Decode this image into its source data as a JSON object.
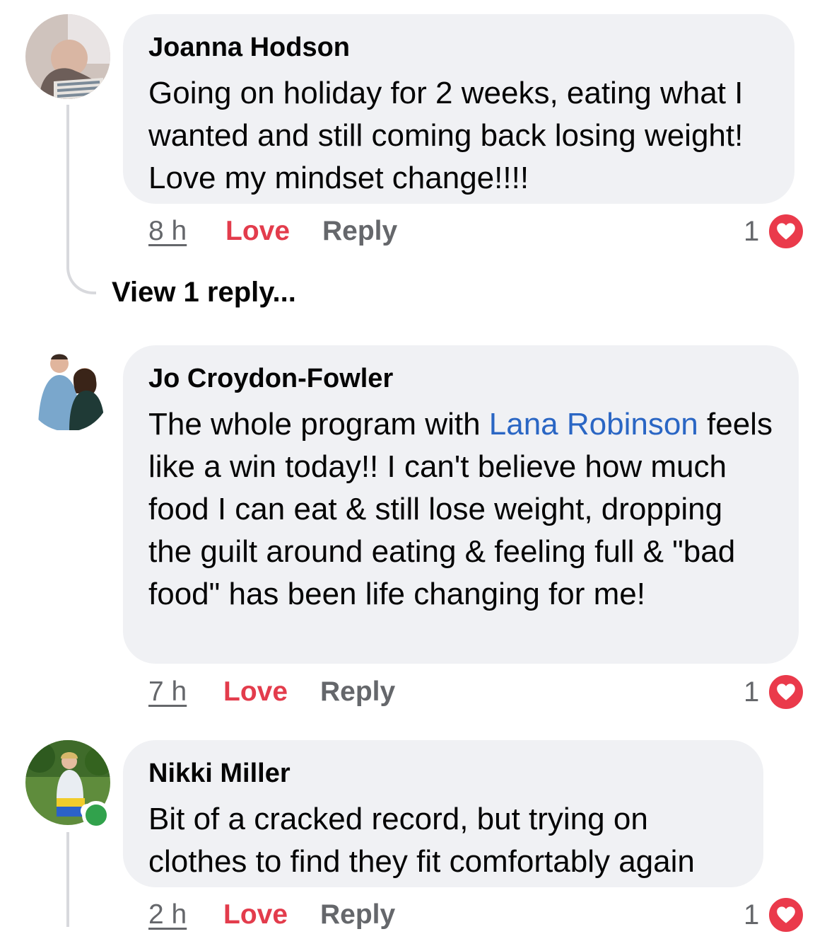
{
  "comments": [
    {
      "author": "Joanna Hodson",
      "text": "Going on holiday for 2 weeks, eating what I wanted and still coming back losing weight! Love my mindset change!!!!",
      "time": "8 h",
      "reaction_label": "Love",
      "reply_label": "Reply",
      "reaction_count": "1",
      "view_replies": "View 1 reply..."
    },
    {
      "author": "Jo Croydon-Fowler",
      "text_before": "The whole program with ",
      "mention": "Lana Robinson",
      "text_after": " feels like a win today!! I can't believe how much food I can eat & still lose weight, dropping the guilt around eating & feeling full & \"bad food\" has been life changing for me!",
      "time": "7 h",
      "reaction_label": "Love",
      "reply_label": "Reply",
      "reaction_count": "1"
    },
    {
      "author": "Nikki Miller",
      "text": "Bit of a cracked record, but trying on clothes to find they fit comfortably again",
      "time": "2 h",
      "reaction_label": "Love",
      "reply_label": "Reply",
      "reaction_count": "1",
      "online": true
    }
  ],
  "colors": {
    "bubble": "#f0f1f4",
    "love": "#e33c4c",
    "mention": "#2a66c4",
    "meta": "#65676b",
    "online": "#31a24c"
  }
}
